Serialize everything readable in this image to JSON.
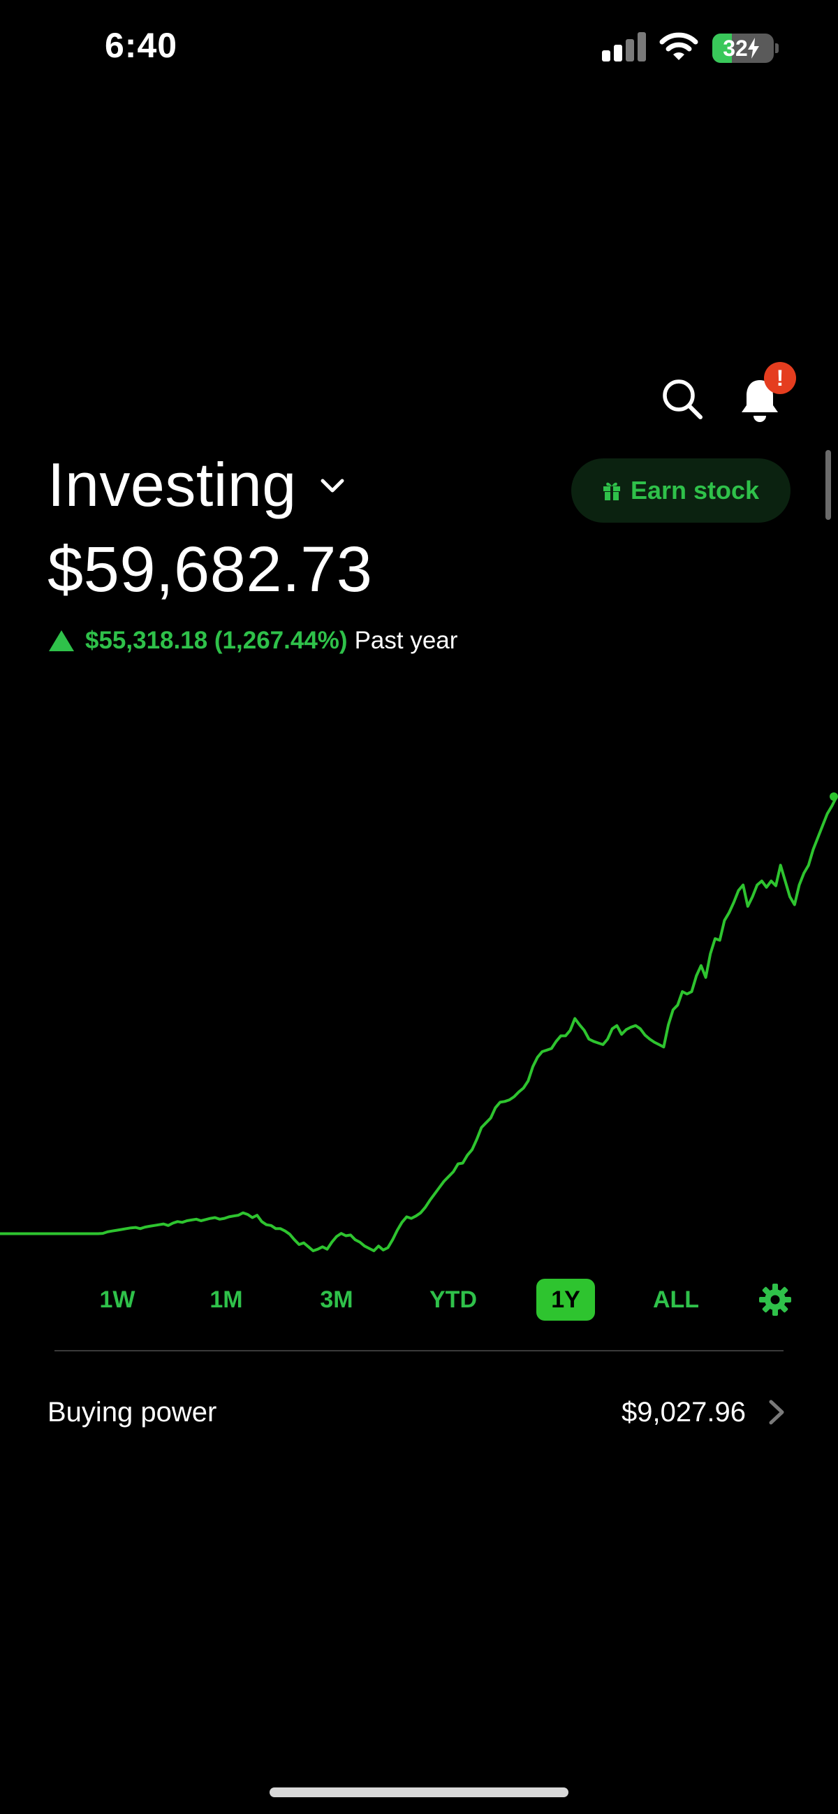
{
  "status_bar": {
    "time": "6:40",
    "battery_level": "32",
    "battery_fraction": 0.32
  },
  "header": {
    "notification_badge": "!",
    "icons": [
      "search-icon",
      "bell-icon"
    ]
  },
  "account": {
    "title": "Investing",
    "earn_button_label": "Earn stock",
    "portfolio_value": "$59,682.73",
    "change_amount": "$55,318.18 (1,267.44%)",
    "change_period": "Past year"
  },
  "chart_data": {
    "type": "line",
    "title": "",
    "xlabel": "",
    "ylabel": "",
    "grid": false,
    "series": [
      {
        "values": [
          4364.55,
          4364.55,
          4364.55,
          4364.55,
          4364.55,
          4364.55,
          4364.55,
          4364.55,
          4364.55,
          4364.55,
          4364.55,
          4364.55,
          4364.55,
          4364.55,
          4364.55,
          4364.55,
          4364.55,
          4364.55,
          4364.55,
          4364.55,
          4364.55,
          4364.55,
          4400,
          4600,
          4700,
          4800,
          4900,
          5000,
          5100,
          5150,
          5000,
          5200,
          5300,
          5400,
          5500,
          5600,
          5400,
          5700,
          5900,
          5800,
          6000,
          6100,
          6200,
          6000,
          6150,
          6300,
          6400,
          6200,
          6300,
          6500,
          6600,
          6700,
          7000,
          6800,
          6400,
          6700,
          5900,
          5500,
          5400,
          5000,
          5000,
          4700,
          4300,
          3600,
          3000,
          3200,
          2700,
          2200,
          2400,
          2700,
          2400,
          3300,
          4000,
          4400,
          4100,
          4200,
          3600,
          3300,
          2800,
          2500,
          2200,
          2800,
          2300,
          2600,
          3600,
          4800,
          5800,
          6500,
          6300,
          6600,
          7000,
          7700,
          8600,
          9400,
          10200,
          11000,
          11600,
          12200,
          13200,
          13300,
          14300,
          15000,
          16300,
          17800,
          18400,
          19000,
          20300,
          21000,
          21100,
          21300,
          21700,
          22300,
          22800,
          23700,
          25500,
          26700,
          27400,
          27600,
          27800,
          28700,
          29400,
          29400,
          30100,
          31600,
          30800,
          30100,
          29000,
          28700,
          28500,
          28300,
          29000,
          30300,
          30700,
          29600,
          30200,
          30500,
          30700,
          30300,
          29500,
          29000,
          28600,
          28300,
          28000,
          30800,
          32700,
          33300,
          35000,
          34700,
          35000,
          37000,
          38300,
          36800,
          39800,
          41700,
          41500,
          44000,
          45000,
          46300,
          47800,
          48500,
          45800,
          47000,
          48500,
          49000,
          48200,
          49000,
          48400,
          51000,
          49000,
          47000,
          46000,
          48500,
          50000,
          51000,
          53000,
          54500,
          56000,
          57500,
          58500,
          59682.73
        ]
      }
    ]
  },
  "ranges": {
    "options": [
      "1W",
      "1M",
      "3M",
      "YTD",
      "1Y",
      "ALL"
    ],
    "selected": "1Y"
  },
  "buying_power": {
    "label": "Buying power",
    "value": "$9,027.96"
  },
  "colors": {
    "background": "#000000",
    "accent_green": "#2fc14a",
    "chart_line": "#2ec42f",
    "badge_red": "#e53d1f",
    "text": "#ffffff"
  }
}
